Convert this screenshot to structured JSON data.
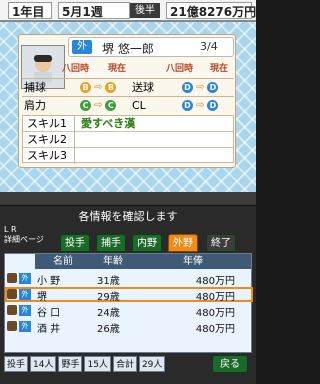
{
  "hud": {
    "year": "1年目",
    "month": "5月1週",
    "half": "後半",
    "money": "21億8276万円"
  },
  "player": {
    "position_badge": "外",
    "name": "堺 悠一郎",
    "count": "3/4"
  },
  "stats_header": {
    "eight": "八回時",
    "now": "現在"
  },
  "stats": [
    {
      "label": "捕球",
      "from": "B",
      "to": "B",
      "label2": "送球",
      "from2": "D",
      "to2": "D"
    },
    {
      "label": "肩力",
      "from": "C",
      "to": "C",
      "label2": "CL",
      "from2": "D",
      "to2": "D"
    }
  ],
  "skills": {
    "labels": [
      "スキル1",
      "スキル2",
      "スキル3"
    ],
    "values": [
      "愛すべき漢",
      "",
      ""
    ]
  },
  "bottom": {
    "message": "各情報を確認します",
    "lr_label": "L R",
    "detail_page": "詳細ページ",
    "tabs": [
      "投手",
      "捕手",
      "内野",
      "外野",
      "終了"
    ],
    "active_tab": 3,
    "headers": [
      "名前",
      "年齢",
      "年俸"
    ],
    "rows": [
      {
        "badge": "外",
        "name": "小 野",
        "age": "31歳",
        "salary": "480万円"
      },
      {
        "badge": "外",
        "name": "堺",
        "age": "29歳",
        "salary": "480万円"
      },
      {
        "badge": "外",
        "name": "谷 口",
        "age": "24歳",
        "salary": "480万円"
      },
      {
        "badge": "外",
        "name": "酒 井",
        "age": "26歳",
        "salary": "480万円"
      }
    ],
    "footer": {
      "pitcher_label": "投手",
      "pitcher_count": "14人",
      "fielder_label": "野手",
      "fielder_count": "15人",
      "total_label": "合計",
      "total_count": "29人"
    },
    "back": "戻る"
  }
}
